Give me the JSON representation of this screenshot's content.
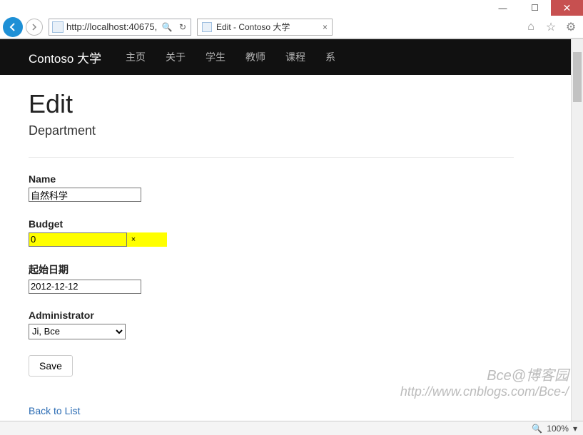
{
  "window": {
    "minimize": "—",
    "maximize": "☐",
    "close": "✕"
  },
  "toolbar": {
    "url": "http://localhost:40675,",
    "search_glyph": "🔍",
    "refresh_glyph": "↻",
    "tab_title": "Edit - Contoso 大学",
    "tab_close": "×",
    "home_glyph": "⌂",
    "star_glyph": "☆",
    "gear_glyph": "⚙"
  },
  "navbar": {
    "brand": "Contoso 大学",
    "links": [
      "主页",
      "关于",
      "学生",
      "教师",
      "课程",
      "系"
    ]
  },
  "page": {
    "heading": "Edit",
    "subheading": "Department",
    "form": {
      "name_label": "Name",
      "name_value": "自然科学",
      "budget_label": "Budget",
      "budget_value": "0",
      "budget_clear": "×",
      "startdate_label": "起始日期",
      "startdate_value": "2012-12-12",
      "admin_label": "Administrator",
      "admin_value": "Ji, Bce",
      "save_label": "Save"
    },
    "back_link": "Back to List"
  },
  "watermark": {
    "line1": "Bce@博客园",
    "line2": "http://www.cnblogs.com/Bce-/"
  },
  "statusbar": {
    "zoom": "100%"
  }
}
